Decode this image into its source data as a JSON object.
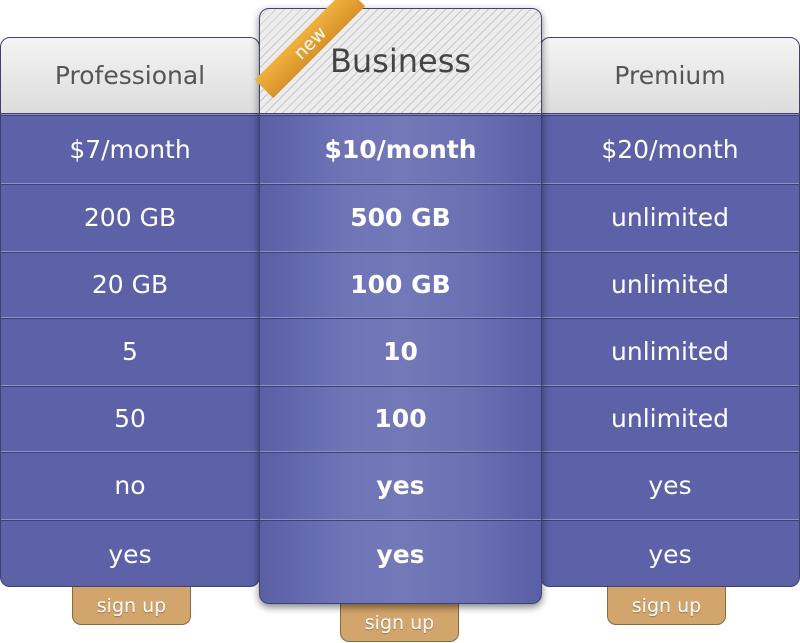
{
  "badge": "new",
  "plans": [
    {
      "name": "Professional",
      "rows": [
        "$7/month",
        "200 GB",
        "20 GB",
        "5",
        "50",
        "no",
        "yes"
      ],
      "signup": "sign up"
    },
    {
      "name": "Business",
      "rows": [
        "$10/month",
        "500 GB",
        "100 GB",
        "10",
        "100",
        "yes",
        "yes"
      ],
      "signup": "sign up"
    },
    {
      "name": "Premium",
      "rows": [
        "$20/month",
        "unlimited",
        "unlimited",
        "unlimited",
        "unlimited",
        "yes",
        "yes"
      ],
      "signup": "sign up"
    }
  ],
  "colors": {
    "table": "#5c61a8",
    "button": "#d2a56c",
    "ribbon": "#e8a535"
  }
}
